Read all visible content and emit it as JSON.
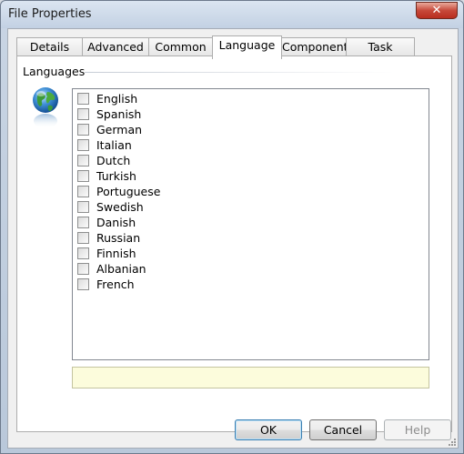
{
  "window": {
    "title": "File Properties",
    "close_icon": "close-icon"
  },
  "tabs": [
    {
      "label": "Details",
      "active": false
    },
    {
      "label": "Advanced",
      "active": false
    },
    {
      "label": "Common",
      "active": false
    },
    {
      "label": "Language",
      "active": true
    },
    {
      "label": "Component",
      "active": false
    },
    {
      "label": "Task",
      "active": false
    }
  ],
  "panel": {
    "group_label": "Languages",
    "icon": "globe-icon",
    "languages": [
      {
        "label": "English",
        "checked": false
      },
      {
        "label": "Spanish",
        "checked": false
      },
      {
        "label": "German",
        "checked": false
      },
      {
        "label": "Italian",
        "checked": false
      },
      {
        "label": "Dutch",
        "checked": false
      },
      {
        "label": "Turkish",
        "checked": false
      },
      {
        "label": "Portuguese",
        "checked": false
      },
      {
        "label": "Swedish",
        "checked": false
      },
      {
        "label": "Danish",
        "checked": false
      },
      {
        "label": "Russian",
        "checked": false
      },
      {
        "label": "Finnish",
        "checked": false
      },
      {
        "label": "Albanian",
        "checked": false
      },
      {
        "label": "French",
        "checked": false
      }
    ],
    "info_text": ""
  },
  "buttons": {
    "ok": "OK",
    "cancel": "Cancel",
    "help": "Help",
    "help_enabled": false
  },
  "colors": {
    "info_background": "#fcfcdc",
    "close_button": "#c7493a"
  }
}
